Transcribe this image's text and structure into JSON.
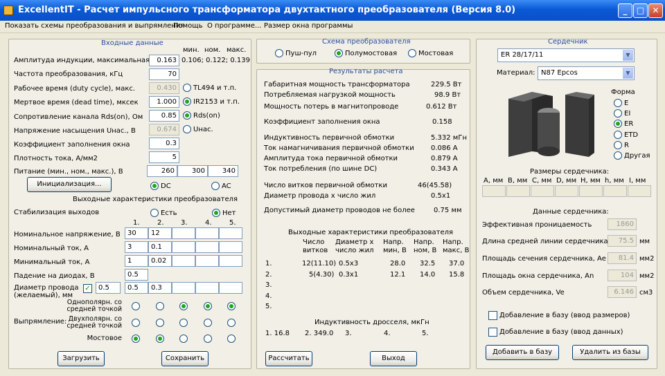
{
  "window": {
    "title": "ExcellentIT - Расчет импульсного трансформатора двухтактного преобразователя (Версия 8.0)"
  },
  "menu": [
    "Показать схемы преобразования и выпрямления",
    "Помощь",
    "О программе...",
    "Размер окна программы"
  ],
  "input_panel": {
    "title": "Входные данные",
    "mnm_headers": [
      "мин.",
      "ном.",
      "макс."
    ],
    "fields": [
      {
        "label": "Амплитуда индукции, максимальная, Т",
        "value": "0.163",
        "extra": "0.106; 0.122; 0.139"
      },
      {
        "label": "Частота преобразования, кГц",
        "value": "70"
      },
      {
        "label": "Рабочее время (duty cycle), макс.",
        "value": "0.430"
      },
      {
        "label": "Мертвое время (dead time), мксек",
        "value": "1.000"
      },
      {
        "label": "Сопротивление канала Rds(on), Ом",
        "value": "0.85"
      },
      {
        "label": "Напряжение насыщения Uнас., В",
        "value": "0.674"
      },
      {
        "label": "Коэффициент заполнения окна",
        "value": "0.3"
      },
      {
        "label": "Плотность тока, А/мм2",
        "value": "5"
      }
    ],
    "ic_options": [
      "TL494 и т.п.",
      "IR2153 и т.п.",
      "Rds(on)",
      "Uнас."
    ],
    "supply_label": "Питание (мин., ном., макс.), В",
    "supply_values": [
      "260",
      "300",
      "340"
    ],
    "init_button": "Инициализация...",
    "dc_label": "DC",
    "ac_label": "AC"
  },
  "output_panel": {
    "title": "Выходные характеристики преобразователя",
    "stab_label": "Стабилизация выходов",
    "stab_yes": "Есть",
    "stab_no": "Нет",
    "col_headers": [
      "1.",
      "2.",
      "3.",
      "4.",
      "5."
    ],
    "rows": [
      {
        "label": "Номинальное напряжение, В",
        "values": [
          "30",
          "12",
          "",
          "",
          ""
        ]
      },
      {
        "label": "Номинальный ток, А",
        "values": [
          "3",
          "0.1",
          "",
          "",
          ""
        ]
      },
      {
        "label": "Минимальный ток, А",
        "values": [
          "1",
          "0.02",
          "",
          "",
          ""
        ]
      }
    ],
    "diode_label": "Падение на диодах, В",
    "diode_value": "0.5",
    "wire_label_1": "Диаметр провода",
    "wire_label_2": "(желаемый), мм",
    "wire_check": "✓",
    "wire_default": "0.5",
    "wire_values": [
      "0.5",
      "0.3",
      "",
      "",
      ""
    ],
    "rect_label": "Выпрямление:",
    "rect_types": [
      "Однополярн. со средней точкой",
      "Двухполярн. со средней точкой",
      "Мостовое"
    ],
    "load_button": "Загрузить",
    "save_button": "Сохранить"
  },
  "scheme": {
    "title": "Схема преобразователя",
    "options": [
      "Пуш-пул",
      "Полумостовая",
      "Мостовая"
    ]
  },
  "results": {
    "title": "Результаты расчета",
    "group1": [
      {
        "label": "Габаритная мощность трансформатора",
        "value": "229.5 Вт"
      },
      {
        "label": "Потребляемая нагрузкой мощность",
        "value": "98.9 Вт"
      },
      {
        "label": "Мощность потерь в магнитопроводе",
        "value": "0.612 Вт"
      }
    ],
    "fill_label": "Коэффициент заполнения окна",
    "fill_value": "0.158",
    "group2": [
      {
        "label": "Индуктивность первичной обмотки",
        "value": "5.332 мГн"
      },
      {
        "label": "Ток намагничивания первичной обмотки",
        "value": "0.086 А"
      },
      {
        "label": "Амплитуда тока первичной обмотки",
        "value": "0.879 А"
      },
      {
        "label": "Ток потребления (по шине DC)",
        "value": "0.343 А"
      }
    ],
    "group3": [
      {
        "label": "Число витков первичной обмотки",
        "value": "46(45.58)"
      },
      {
        "label": "Диаметр провода х число жил",
        "value": "0.5x1"
      }
    ],
    "allowed_label": "Допустимый диаметр проводов не более",
    "allowed_value": "0.75 мм",
    "out_title": "Выходные характеристики преобразователя",
    "out_headers": [
      [
        "Число",
        "витков"
      ],
      [
        "Диаметр х",
        "число жил"
      ],
      [
        "Напр.",
        "мин, В"
      ],
      [
        "Напр.",
        "ном, В"
      ],
      [
        "Напр.",
        "макс, В"
      ]
    ],
    "out_rows": [
      {
        "n": "1.",
        "turns": "12(11.10)",
        "diam": "0.5x3",
        "vmin": "28.0",
        "vnom": "32.5",
        "vmax": "37.0"
      },
      {
        "n": "2.",
        "turns": "5(4.30)",
        "diam": "0.3x1",
        "vmin": "12.1",
        "vnom": "14.0",
        "vmax": "15.8"
      },
      {
        "n": "3.",
        "turns": "",
        "diam": "",
        "vmin": "",
        "vnom": "",
        "vmax": ""
      },
      {
        "n": "4.",
        "turns": "",
        "diam": "",
        "vmin": "",
        "vnom": "",
        "vmax": ""
      },
      {
        "n": "5.",
        "turns": "",
        "diam": "",
        "vmin": "",
        "vnom": "",
        "vmax": ""
      }
    ],
    "choke_title": "Индуктивность дросселя, мкГн",
    "choke": [
      "1. 16.8",
      "2. 349.0",
      "3.",
      "4.",
      "5."
    ],
    "calc_button": "Рассчитать",
    "exit_button": "Выход"
  },
  "core": {
    "title": "Сердечник",
    "selected": "ER 28/17/11",
    "material_label": "Материал:",
    "material": "N87 Epcos",
    "shape_label": "Форма",
    "shapes": [
      "E",
      "EI",
      "ER",
      "ETD",
      "R",
      "Другая"
    ],
    "dims_title": "Размеры сердечника:",
    "dims": [
      "A, мм",
      "B, мм",
      "C, мм",
      "D, мм",
      "H, мм",
      "h, мм",
      "I, мм"
    ],
    "data_title": "Данные сердечника:",
    "data": [
      {
        "label": "Эффективная проницаемость",
        "value": "1860",
        "unit": ""
      },
      {
        "label": "Длина средней линии сердечника, le",
        "value": "75.5",
        "unit": "мм"
      },
      {
        "label": "Площадь сечения сердечника, Ae",
        "value": "81.4",
        "unit": "мм2"
      },
      {
        "label": "Площадь окна сердечника, An",
        "value": "104",
        "unit": "мм2"
      },
      {
        "label": "Объем сердечника, Ve",
        "value": "6.146",
        "unit": "см3"
      }
    ],
    "add_dims": "Добавление в базу (ввод размеров)",
    "add_data": "Добавление в базу (ввод данных)",
    "add_button": "Добавить в базу",
    "del_button": "Удалить из базы"
  }
}
